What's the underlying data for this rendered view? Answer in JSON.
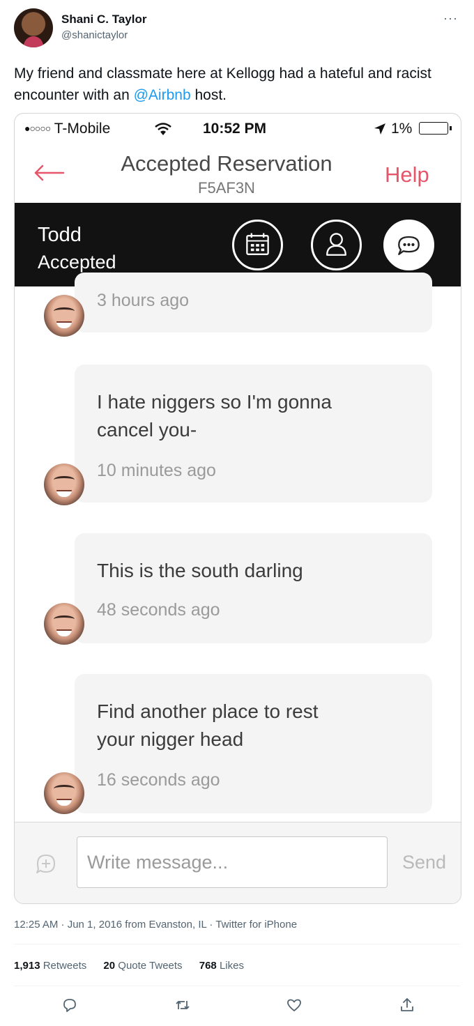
{
  "tweet": {
    "author_name": "Shani C. Taylor",
    "author_handle": "@shanictaylor",
    "text_before": "My friend and classmate here at Kellogg had a hateful and racist encounter with an ",
    "mention": "@Airbnb",
    "text_after": " host.",
    "meta": "12:25 AM · Jun 1, 2016 from Evanston, IL · Twitter for iPhone",
    "retweets_count": "1,913",
    "retweets_label": "Retweets",
    "quotes_count": "20",
    "quotes_label": "Quote Tweets",
    "likes_count": "768",
    "likes_label": "Likes",
    "more_icon": "···"
  },
  "screenshot": {
    "status_bar": {
      "signal": "●○○○○",
      "carrier": "T-Mobile",
      "time": "10:52 PM",
      "battery": "1%"
    },
    "nav": {
      "title": "Accepted Reservation",
      "code": "F5AF3N",
      "help": "Help",
      "accent_color": "#e5566b"
    },
    "host": {
      "name": "Todd",
      "status": "Accepted"
    },
    "messages": [
      {
        "text": "",
        "time": "3 hours ago"
      },
      {
        "text_lines": [
          "I hate niggers so I'm gonna",
          "cancel you-"
        ],
        "time": "10 minutes ago"
      },
      {
        "text_lines": [
          "This is the south darling"
        ],
        "time": "48 seconds ago"
      },
      {
        "text_lines": [
          "Find another place to rest",
          "your nigger head"
        ],
        "time": "16 seconds ago"
      }
    ],
    "compose": {
      "placeholder": "Write message...",
      "send": "Send"
    }
  }
}
